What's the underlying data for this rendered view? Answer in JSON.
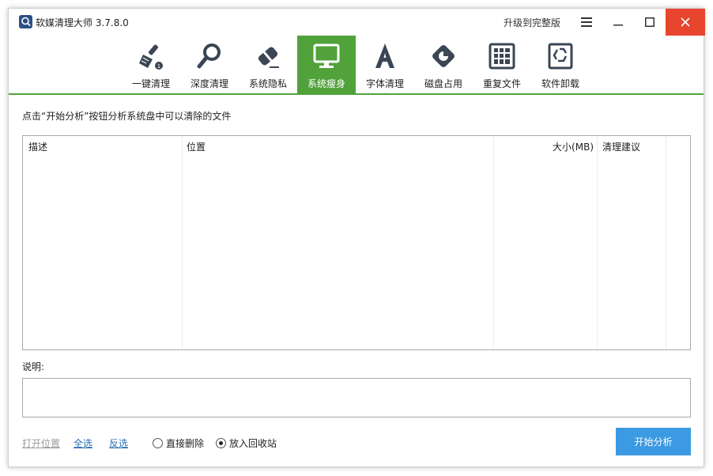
{
  "window": {
    "title": "软媒清理大师 3.7.8.0",
    "upgrade_label": "升级到完整版"
  },
  "colors": {
    "accent_green": "#52a23c",
    "primary_blue": "#3b9ae1",
    "close_red": "#e8452f",
    "icon_dark": "#3a4654"
  },
  "toolbar": {
    "items": [
      {
        "label": "一键清理",
        "icon": "broom-icon"
      },
      {
        "label": "深度清理",
        "icon": "magnifier-icon"
      },
      {
        "label": "系统隐私",
        "icon": "eraser-icon"
      },
      {
        "label": "系统瘦身",
        "icon": "monitor-icon",
        "active": true
      },
      {
        "label": "字体清理",
        "icon": "font-a-icon"
      },
      {
        "label": "磁盘占用",
        "icon": "disk-pie-icon"
      },
      {
        "label": "重复文件",
        "icon": "grid-file-icon"
      },
      {
        "label": "软件卸载",
        "icon": "recycle-icon"
      }
    ]
  },
  "main": {
    "hint": "点击“开始分析”按钮分析系统盘中可以清除的文件",
    "table": {
      "columns": [
        "描述",
        "位置",
        "大小(MB)",
        "清理建议"
      ],
      "rows": []
    },
    "description_label": "说明:",
    "description_text": ""
  },
  "footer": {
    "open_location": "打开位置",
    "select_all": "全选",
    "invert_select": "反选",
    "radio_direct_delete": "直接删除",
    "radio_recycle_bin": "放入回收站",
    "selected_option": "放入回收站",
    "start_button": "开始分析"
  }
}
